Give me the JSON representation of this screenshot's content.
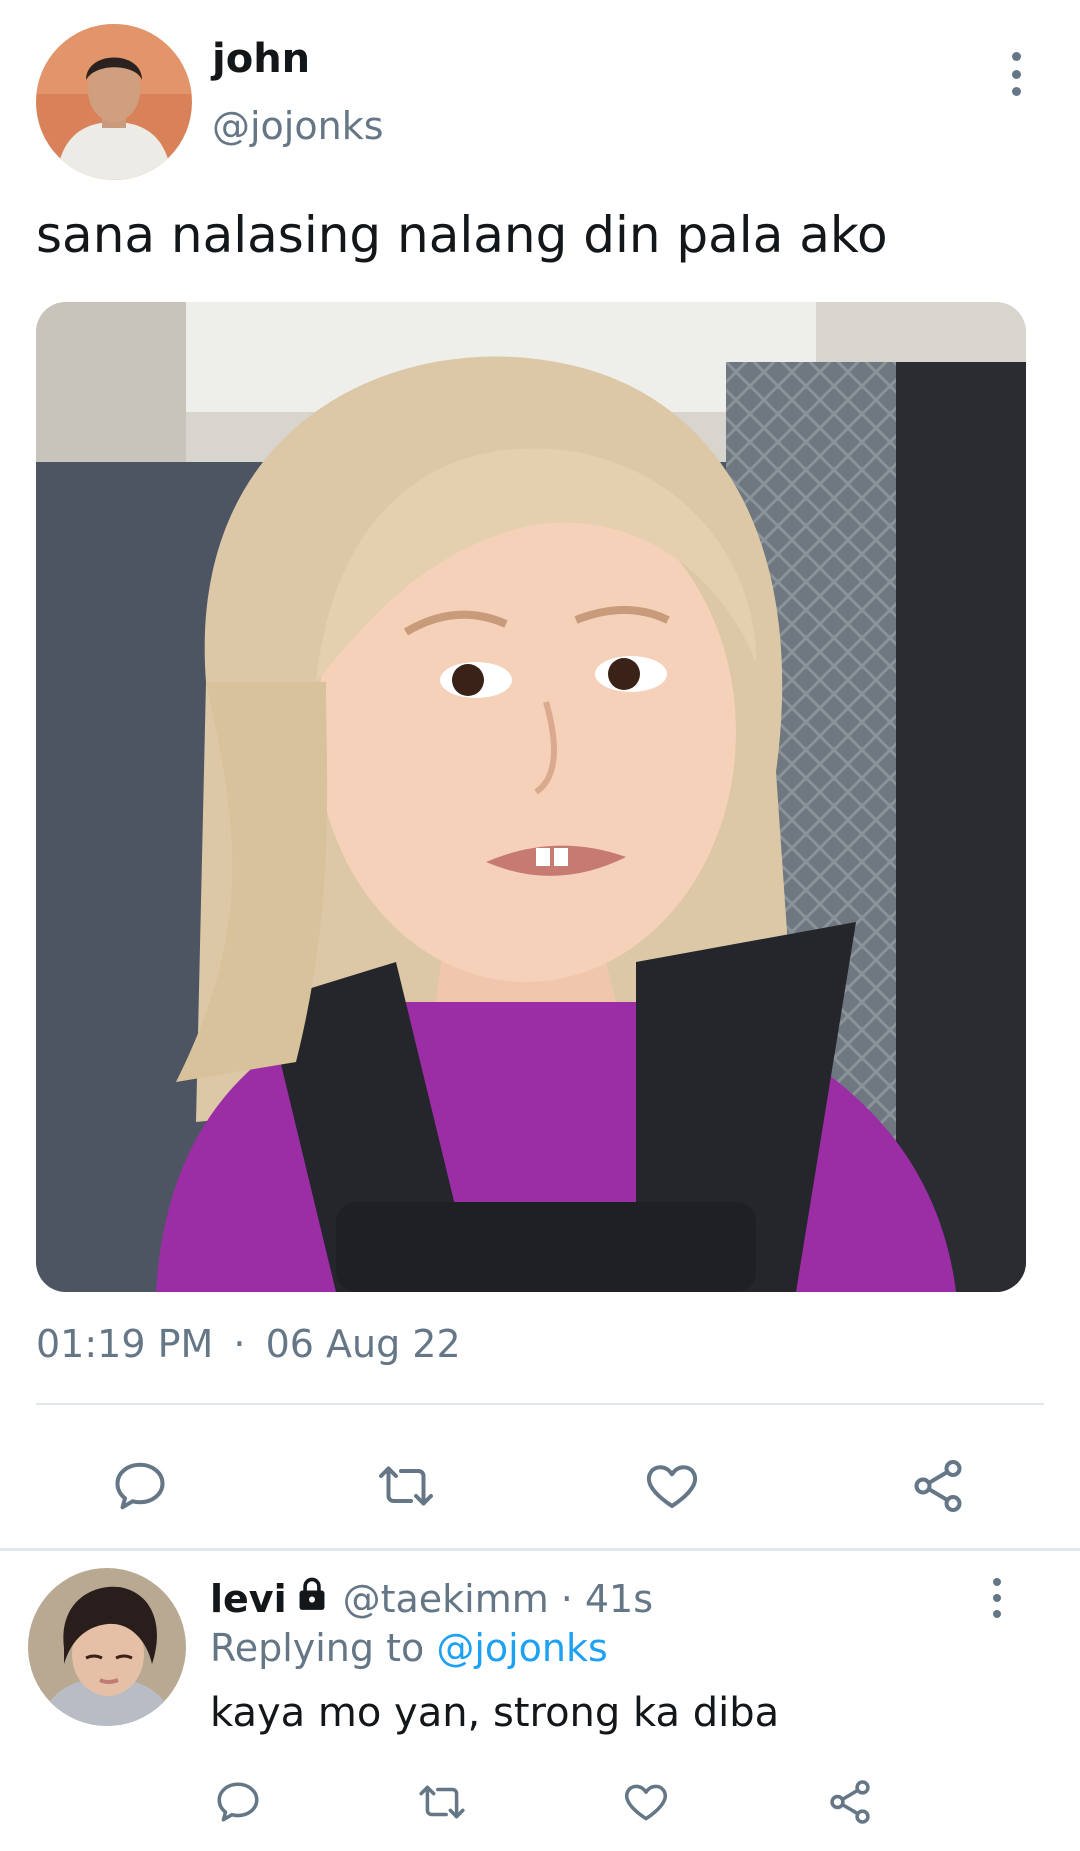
{
  "tweet": {
    "author_name": "john",
    "author_handle": "@jojonks",
    "text": "sana nalasing nalang din pala ako",
    "media_icon": "photo",
    "time": "01:19 PM",
    "separator": "·",
    "date": "06 Aug 22"
  },
  "actions": [
    {
      "icon": "reply-icon"
    },
    {
      "icon": "retweet-icon"
    },
    {
      "icon": "like-icon"
    },
    {
      "icon": "share-icon"
    }
  ],
  "reply": {
    "author_name": "levi",
    "author_handle": "@taekimm",
    "separator": "·",
    "age": "41s",
    "replying_prefix": "Replying to ",
    "replying_handle": "@jojonks",
    "text": "kaya mo yan, strong ka diba"
  },
  "colors": {
    "text": "#14171a",
    "secondary": "#657786",
    "link": "#1da1f2",
    "divider": "#e1e8ed"
  }
}
